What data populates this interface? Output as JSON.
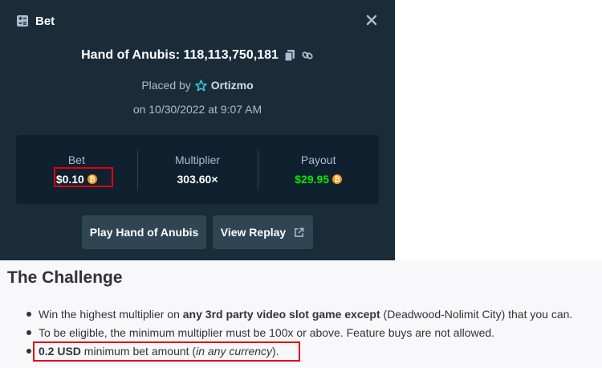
{
  "modal": {
    "title": "Bet",
    "title_icon": "bet-slip-icon",
    "close_icon": "close-icon",
    "game_name_id": "Hand of Anubis: 118,113,750,181",
    "placed_by_label": "Placed by",
    "username": "Ortizmo",
    "date": "on 10/30/2022 at 9:07 AM",
    "stats": {
      "bet_label": "Bet",
      "bet_value": "$0.10",
      "multiplier_label": "Multiplier",
      "multiplier_value": "303.60×",
      "payout_label": "Payout",
      "payout_value": "$29.95"
    },
    "coin_symbol": "₿",
    "play_button": "Play Hand of Anubis",
    "replay_button": "View Replay"
  },
  "article": {
    "heading": "The Challenge",
    "bullets": [
      {
        "a": "Win the highest multiplier on ",
        "b": "any 3rd party video slot game except",
        "c": " (Deadwood-Nolimit City) that you can."
      },
      {
        "a": "To be eligible, the minimum multiplier must be 100x or above. Feature buys are not allowed."
      },
      {
        "b": "0.2 USD",
        "a": " minimum bet amount (",
        "i": "in any currency",
        "c": ")."
      }
    ]
  },
  "colors": {
    "modal_bg": "#1a2c38",
    "stats_bg": "#0f212e",
    "button_bg": "#2f4553",
    "payout_green": "#00e701",
    "highlight_red": "#e3000f",
    "coin_orange": "#f7931a"
  }
}
